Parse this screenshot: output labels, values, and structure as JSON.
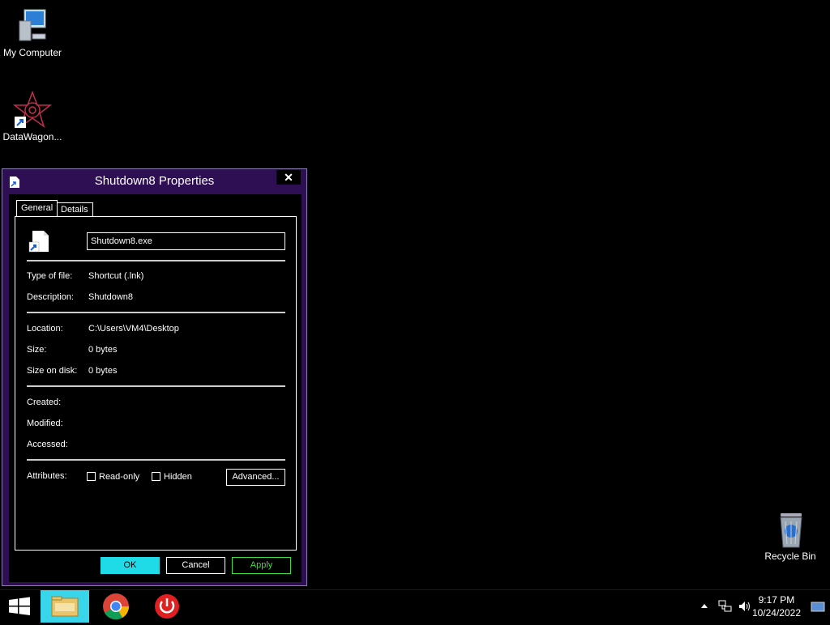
{
  "desktop": {
    "icons": [
      {
        "label": "My Computer",
        "icon": "computer-icon"
      },
      {
        "label": "DataWagon...",
        "icon": "datawagon-shortcut-icon"
      },
      {
        "label": "Recycle Bin",
        "icon": "recycle-bin-icon"
      }
    ]
  },
  "dialog": {
    "title": "Shutdown8 Properties",
    "close_label": "✕",
    "tabs": [
      "General",
      "Details"
    ],
    "file_name": "Shutdown8.exe",
    "props": {
      "type_label": "Type of file:",
      "type_value": "Shortcut (.lnk)",
      "description_label": "Description:",
      "description_value": "Shutdown8",
      "location_label": "Location:",
      "location_value": "C:\\Users\\VM4\\Desktop",
      "size_label": "Size:",
      "size_value": "0 bytes",
      "size_on_disk_label": "Size on disk:",
      "size_on_disk_value": "0 bytes",
      "created_label": "Created:",
      "modified_label": "Modified:",
      "accessed_label": "Accessed:",
      "attributes_label": "Attributes:",
      "readonly_label": "Read-only",
      "hidden_label": "Hidden",
      "advanced_label": "Advanced..."
    },
    "buttons": {
      "ok": "OK",
      "cancel": "Cancel",
      "apply": "Apply"
    },
    "colors": {
      "frame": "#2e0f54",
      "ok": "#1fdbe8",
      "apply": "#3dde3d"
    }
  },
  "taskbar": {
    "items": [
      "file-explorer-icon",
      "chrome-icon",
      "shutdown-app-icon"
    ],
    "tray": [
      "arrow-up-icon",
      "network-icon",
      "volume-icon"
    ],
    "time": "9:17 PM",
    "date": "10/24/2022"
  }
}
